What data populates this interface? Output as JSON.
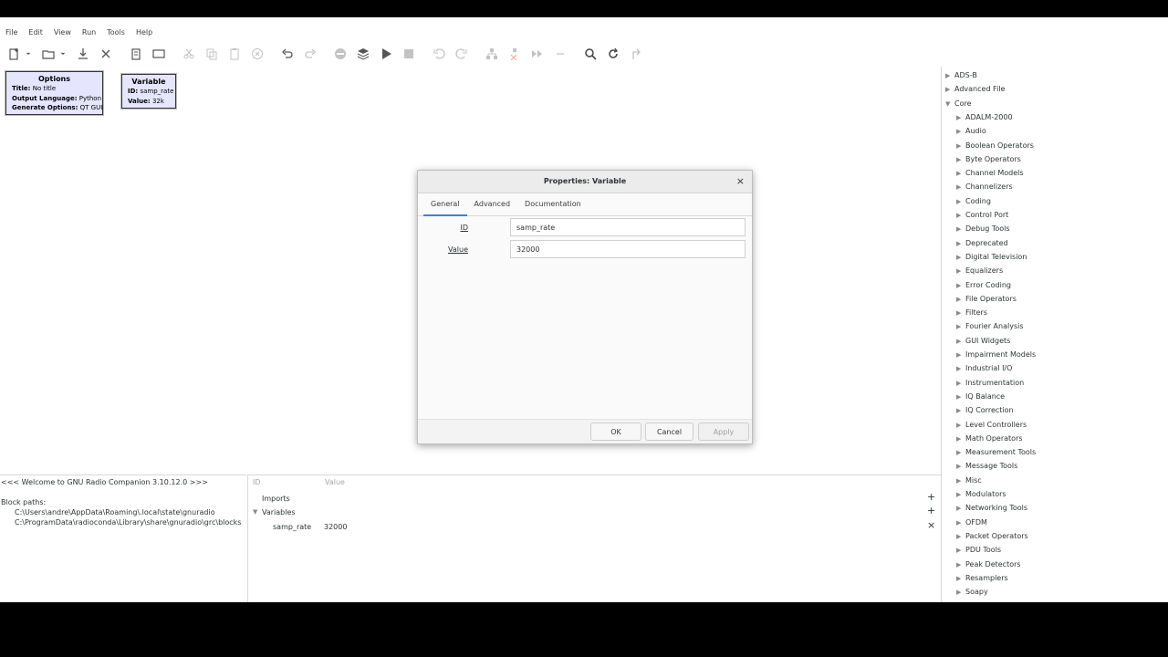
{
  "menu": [
    "File",
    "Edit",
    "View",
    "Run",
    "Tools",
    "Help"
  ],
  "toolbar_icons": [
    {
      "name": "new-icon",
      "dim": false
    },
    {
      "name": "new-dropdown-icon",
      "dim": false,
      "arrow": true
    },
    {
      "name": "open-icon",
      "dim": false
    },
    {
      "name": "open-dropdown-icon",
      "dim": false,
      "arrow": true
    },
    {
      "name": "save-icon",
      "dim": false
    },
    {
      "name": "close-icon",
      "dim": false
    },
    {
      "name": "sep"
    },
    {
      "name": "report-icon",
      "dim": false
    },
    {
      "name": "screenshot-icon",
      "dim": false
    },
    {
      "name": "sep"
    },
    {
      "name": "cut-icon",
      "dim": true
    },
    {
      "name": "copy-icon",
      "dim": true
    },
    {
      "name": "paste-icon",
      "dim": true
    },
    {
      "name": "delete-icon",
      "dim": true
    },
    {
      "name": "sep"
    },
    {
      "name": "undo-icon",
      "dim": false
    },
    {
      "name": "redo-icon",
      "dim": true
    },
    {
      "name": "sep"
    },
    {
      "name": "disable-icon",
      "dim": true
    },
    {
      "name": "bypass-icon",
      "dim": false
    },
    {
      "name": "execute-icon",
      "dim": false
    },
    {
      "name": "stop-icon",
      "dim": true
    },
    {
      "name": "sep"
    },
    {
      "name": "rotate-ccw-icon",
      "dim": true
    },
    {
      "name": "rotate-cw-icon",
      "dim": true
    },
    {
      "name": "sep"
    },
    {
      "name": "create-hier-icon",
      "dim": true
    },
    {
      "name": "remove-hier-icon",
      "dim": true
    },
    {
      "name": "more-icon",
      "dim": true
    },
    {
      "name": "minus-icon",
      "dim": true
    },
    {
      "name": "sep"
    },
    {
      "name": "find-icon",
      "dim": false
    },
    {
      "name": "reload-icon",
      "dim": false
    },
    {
      "name": "jump-icon",
      "dim": true
    }
  ],
  "options_block": {
    "title": "Options",
    "rows": [
      {
        "k": "Title:",
        "v": "No title"
      },
      {
        "k": "Output Language:",
        "v": "Python"
      },
      {
        "k": "Generate Options:",
        "v": "QT GUI"
      }
    ]
  },
  "variable_block": {
    "title": "Variable",
    "rows": [
      {
        "k": "ID:",
        "v": "samp_rate"
      },
      {
        "k": "Value:",
        "v": "32k"
      }
    ]
  },
  "dialog": {
    "title": "Properties: Variable",
    "close": "×",
    "tabs": [
      "General",
      "Advanced",
      "Documentation"
    ],
    "params": [
      {
        "label": "ID",
        "value": "samp_rate"
      },
      {
        "label": "Value",
        "value": "32000"
      }
    ],
    "buttons": {
      "ok": "OK",
      "cancel": "Cancel",
      "apply": "Apply"
    }
  },
  "console": {
    "welcome": "<<< Welcome to GNU Radio Companion 3.10.12.0 >>>",
    "block_paths_label": "Block paths:",
    "paths": [
      "C:\\Users\\andre\\AppData\\Roaming\\.local\\state\\gnuradio",
      "C:\\ProgramData\\radioconda\\Library\\share\\gnuradio\\grc\\blocks"
    ]
  },
  "variables_panel": {
    "header_id": "ID",
    "header_value": "Value",
    "imports": "Imports",
    "variables": "Variables",
    "rows": [
      {
        "id": "samp_rate",
        "value": "32000"
      }
    ],
    "add_symbol": "+",
    "remove_symbol": "×"
  },
  "library": {
    "top": [
      "ADS-B",
      "Advanced File",
      "Core"
    ],
    "core_children": [
      "ADALM-2000",
      "Audio",
      "Boolean Operators",
      "Byte Operators",
      "Channel Models",
      "Channelizers",
      "Coding",
      "Control Port",
      "Debug Tools",
      "Deprecated",
      "Digital Television",
      "Equalizers",
      "Error Coding",
      "File Operators",
      "Filters",
      "Fourier Analysis",
      "GUI Widgets",
      "Impairment Models",
      "Industrial I/O",
      "Instrumentation",
      "IQ Balance",
      "IQ Correction",
      "Level Controllers",
      "Math Operators",
      "Measurement Tools",
      "Message Tools",
      "Misc",
      "Modulators",
      "Networking Tools",
      "OFDM",
      "Packet Operators",
      "PDU Tools",
      "Peak Detectors",
      "Resamplers",
      "Soapy"
    ]
  }
}
